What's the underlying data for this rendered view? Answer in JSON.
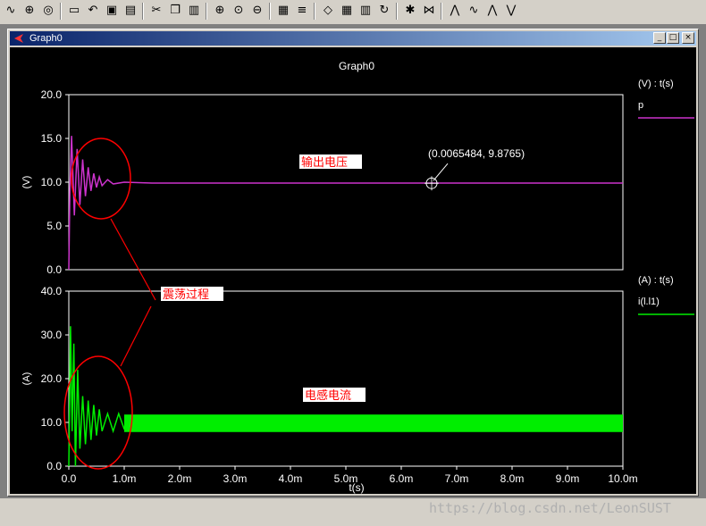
{
  "toolbar": {
    "icons": [
      "waveform-icon",
      "crosshair-icon",
      "target-icon",
      "open-folder-icon",
      "undo-icon",
      "save-icon",
      "print-icon",
      "cut-icon",
      "copy-icon",
      "paste-icon",
      "zoom-in-icon",
      "zoom-fit-icon",
      "zoom-out-icon",
      "bar-chart-icon",
      "legend-icon",
      "eraser-icon",
      "grid-icon",
      "waveform-grid-icon",
      "refresh-icon",
      "pin-icon",
      "bus-icon",
      "cursor-a-icon",
      "cursor-b-icon",
      "peak-icon",
      "trough-icon"
    ]
  },
  "window": {
    "title": "Graph0",
    "controls": {
      "minimize": "_",
      "restore": "□",
      "close": "×"
    }
  },
  "colors": {
    "voltage_trace": "#cc33cc",
    "current_trace": "#00ee00",
    "annotation": "#ff0000",
    "label_bg": "#ffffff",
    "grid": "#ffffff",
    "text": "#ffffff"
  },
  "annotations": {
    "output_voltage": "输出电压",
    "oscillation": "震荡过程",
    "inductor_current": "电感电流",
    "marker": "(0.0065484, 9.8765)"
  },
  "watermark": "https://blog.csdn.net/LeonSUST",
  "chart_data": {
    "type": "line",
    "title": "Graph0",
    "xlabel": "t(s)",
    "xlim": [
      0,
      10.0
    ],
    "x_unit": "ms",
    "x_ticks": [
      "0.0",
      "1.0m",
      "2.0m",
      "3.0m",
      "4.0m",
      "5.0m",
      "6.0m",
      "7.0m",
      "8.0m",
      "9.0m",
      "10.0m"
    ],
    "panels": [
      {
        "ylabel": "(V)",
        "ylim": [
          0,
          20
        ],
        "y_ticks": [
          "20.0",
          "15.0",
          "10.0",
          "5.0",
          "0.0"
        ],
        "y_tick_values": [
          20,
          15,
          10,
          5,
          0
        ],
        "legend_title": "(V) : t(s)",
        "series": [
          {
            "name": "p",
            "x": [
              0,
              0.02,
              0.05,
              0.1,
              0.15,
              0.2,
              0.25,
              0.3,
              0.35,
              0.4,
              0.45,
              0.5,
              0.55,
              0.6,
              0.7,
              0.8,
              1.0,
              1.5,
              2.0,
              10.0
            ],
            "y": [
              0,
              9,
              15.3,
              6.2,
              13.8,
              7.4,
              12.6,
              8.4,
              11.7,
              9.0,
              11.0,
              9.4,
              10.6,
              9.6,
              10.3,
              9.8,
              10.0,
              9.9,
              9.9,
              9.9
            ]
          }
        ]
      },
      {
        "ylabel": "(A)",
        "ylim": [
          0,
          40
        ],
        "y_ticks": [
          "40.0",
          "30.0",
          "20.0",
          "10.0",
          "0.0"
        ],
        "y_tick_values": [
          40,
          30,
          20,
          10,
          0
        ],
        "legend_title": "(A) : t(s)",
        "series": [
          {
            "name": "i(l.l1)",
            "x": [
              0,
              0.03,
              0.06,
              0.09,
              0.12,
              0.16,
              0.2,
              0.25,
              0.3,
              0.35,
              0.4,
              0.45,
              0.5,
              0.55,
              0.6,
              0.7,
              0.8,
              0.9,
              1.0,
              10.0
            ],
            "y": [
              0,
              32,
              8,
              28,
              0,
              22,
              4,
              16,
              5,
              15,
              6,
              14,
              7,
              13,
              8,
              12,
              8,
              12,
              8.5,
              11.5
            ],
            "band": {
              "from_x": 1.0,
              "to_x": 10.0,
              "low": 7.8,
              "high": 11.8
            }
          }
        ]
      }
    ]
  }
}
